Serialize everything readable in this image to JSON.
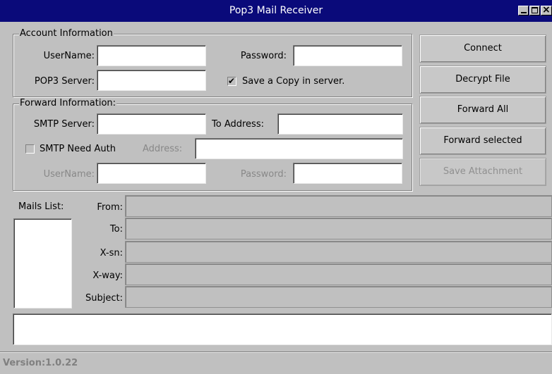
{
  "window": {
    "title": "Pop3 Mail Receiver"
  },
  "account": {
    "legend": "Account Information",
    "username_label": "UserName:",
    "password_label": "Password:",
    "pop3_label": "POP3 Server:",
    "save_copy_label": "Save a Copy in server.",
    "save_copy_checked": true,
    "username_value": "",
    "password_value": "",
    "pop3_value": ""
  },
  "forward": {
    "legend": "Forward Information:",
    "smtp_label": "SMTP Server:",
    "to_label": "To Address:",
    "need_auth_label": "SMTP Need Auth",
    "need_auth_checked": false,
    "address_label": "Address:",
    "username_label": "UserName:",
    "password_label": "Password:",
    "smtp_value": "",
    "to_value": ""
  },
  "buttons": {
    "connect": "Connect",
    "decrypt": "Decrypt File",
    "forward_all": "Forward All",
    "forward_selected": "Forward selected",
    "save_attachment": "Save Attachment"
  },
  "mail": {
    "list_label": "Mails List:",
    "from_label": "From:",
    "to_label": "To:",
    "xsn_label": "X-sn:",
    "xway_label": "X-way:",
    "subject_label": "Subject:"
  },
  "status": {
    "version": "Version:1.0.22"
  },
  "colors": {
    "titlebar": "#0a0a7a",
    "background": "#c0c0c0"
  }
}
